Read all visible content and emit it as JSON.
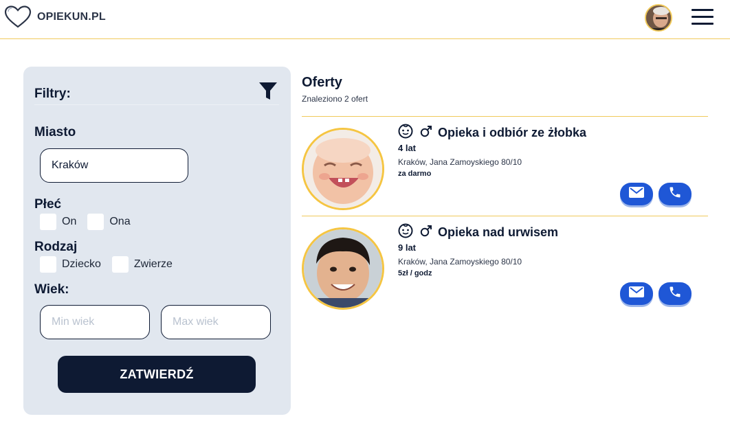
{
  "header": {
    "logo_text": "OPIEKUN.PL",
    "icons": [
      "heart-logo-icon",
      "avatar",
      "hamburger-menu-icon"
    ]
  },
  "filters": {
    "title": "Filtry:",
    "city_label": "Miasto",
    "city_value": "Kraków",
    "gender_label": "Płeć",
    "gender_options": [
      "On",
      "Ona"
    ],
    "type_label": "Rodzaj",
    "type_options": [
      "Dziecko",
      "Zwierze"
    ],
    "age_label": "Wiek:",
    "min_age_placeholder": "Min wiek",
    "max_age_placeholder": "Max wiek",
    "submit_label": "ZATWIERDŹ"
  },
  "offers": {
    "title": "Oferty",
    "count_text": "Znaleziono 2 ofert",
    "items": [
      {
        "title": "Opieka i odbiór ze żłobka",
        "age": "4 lat",
        "address": "Kraków, Jana Zamoyskiego 80/10",
        "price": "za darmo"
      },
      {
        "title": "Opieka nad urwisem",
        "age": "9 lat",
        "address": "Kraków, Jana Zamoyskiego 80/10",
        "price": "5zł / godz"
      }
    ]
  },
  "colors": {
    "navy": "#0e1a33",
    "accent_yellow": "#f0c95a",
    "panel_bg": "#e1e7ef",
    "action_blue": "#1f57d6"
  }
}
